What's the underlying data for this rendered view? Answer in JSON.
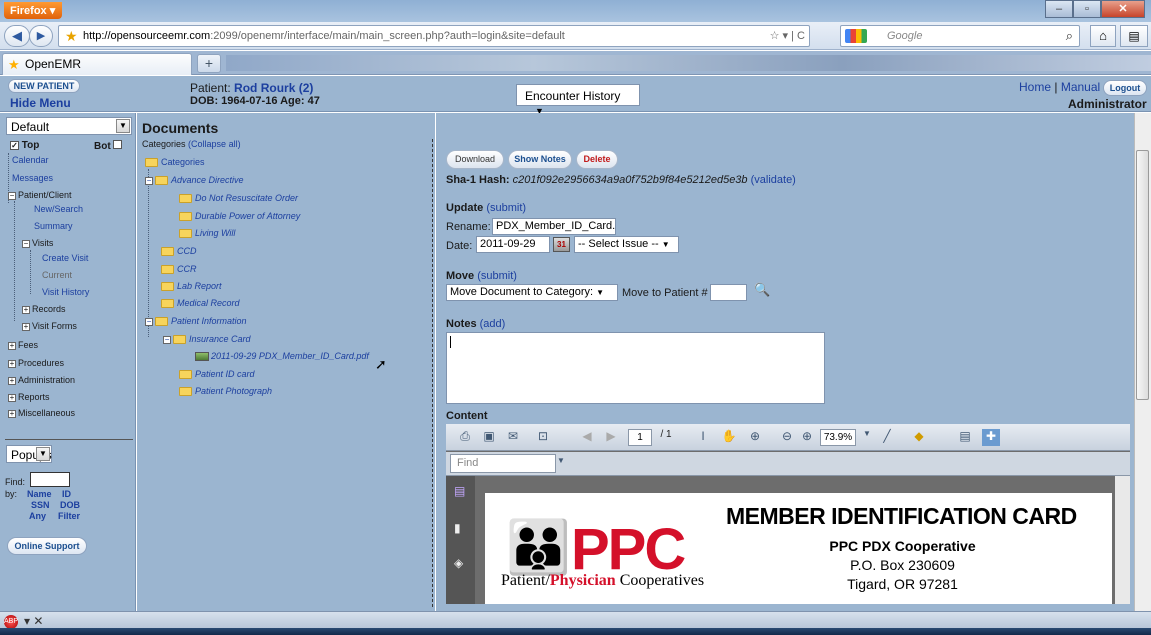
{
  "browser": {
    "app_button": "Firefox",
    "url_host": "http://opensourceemr.com",
    "url_path": ":2099/openemr/interface/main/main_screen.php?auth=login&site=default",
    "search_placeholder": "Google",
    "tab_title": "OpenEMR",
    "new_tab": "+"
  },
  "header": {
    "new_patient": "NEW PATIENT",
    "hide_menu": "Hide Menu",
    "patient_prefix": "Patient:",
    "patient_name": "Rod Rourk (2)",
    "dob_line": "DOB: 1964-07-16 Age: 47",
    "encounter_select": "Encounter History",
    "home": "Home",
    "sep": "|",
    "manual": "Manual",
    "logout": "Logout",
    "user": "Administrator"
  },
  "leftnav": {
    "view_select": "Default",
    "top_label": "Top",
    "bot_label": "Bot",
    "items": [
      "Calendar",
      "Messages",
      "Patient/Client",
      "New/Search",
      "Summary",
      "Visits",
      "Create Visit",
      "Current",
      "Visit History",
      "Records",
      "Visit Forms",
      "Fees",
      "Procedures",
      "Administration",
      "Reports",
      "Miscellaneous"
    ],
    "popups_select": "Popups",
    "find_label": "Find:",
    "by_label": "by:",
    "find_by": [
      "Name",
      "ID",
      "SSN",
      "DOB",
      "Any",
      "Filter"
    ],
    "online_support": "Online Support"
  },
  "documents": {
    "title": "Documents",
    "categories_label": "Categories",
    "collapse_all": "(Collapse all)",
    "tree": [
      "Categories",
      "Advance Directive",
      "Do Not Resuscitate Order",
      "Durable Power of Attorney",
      "Living Will",
      "CCD",
      "CCR",
      "Lab Report",
      "Medical Record",
      "Patient Information",
      "Insurance Card",
      "2011-09-29 PDX_Member_ID_Card.pdf",
      "Patient ID card",
      "Patient Photograph"
    ]
  },
  "detail": {
    "download": "Download",
    "show_notes": "Show Notes",
    "delete": "Delete",
    "sha_label": "Sha-1 Hash:",
    "sha_value": "c201f092e2956634a9a0f752b9f84e5212ed5e3b",
    "validate": "(validate)",
    "update_label": "Update",
    "submit": "(submit)",
    "rename_label": "Rename:",
    "rename_value": "PDX_Member_ID_Card.",
    "date_label": "Date:",
    "date_value": "2011-09-29",
    "issue_select": "-- Select Issue --",
    "move_label": "Move",
    "move_select": "Move Document to Category:",
    "move_patient": "Move to Patient #",
    "notes_label": "Notes",
    "add": "(add)",
    "content_label": "Content"
  },
  "pdf": {
    "page_current": "1",
    "page_total": "/ 1",
    "zoom": "73.9%",
    "find_placeholder": "Find",
    "ppc": "PPC",
    "tag_a": "Patient/",
    "tag_b": "Physician",
    "tag_c": " Cooperatives",
    "card_title": "MEMBER IDENTIFICATION CARD",
    "org": "PPC PDX Cooperative",
    "box": "P.O. Box 230609",
    "city": "Tigard, OR 97281"
  },
  "icons": [
    "firefox-icon",
    "back-icon",
    "forward-icon",
    "star-icon",
    "refresh-icon",
    "search-icon",
    "home-icon",
    "bookmark-menu-icon",
    "calendar-icon",
    "magnify-icon",
    "print-icon",
    "save-icon",
    "email-icon",
    "hand-icon",
    "zoom-in-icon",
    "zoom-out-icon",
    "pen-icon",
    "highlight-icon",
    "fit-icon",
    "thumbnail-icon"
  ]
}
